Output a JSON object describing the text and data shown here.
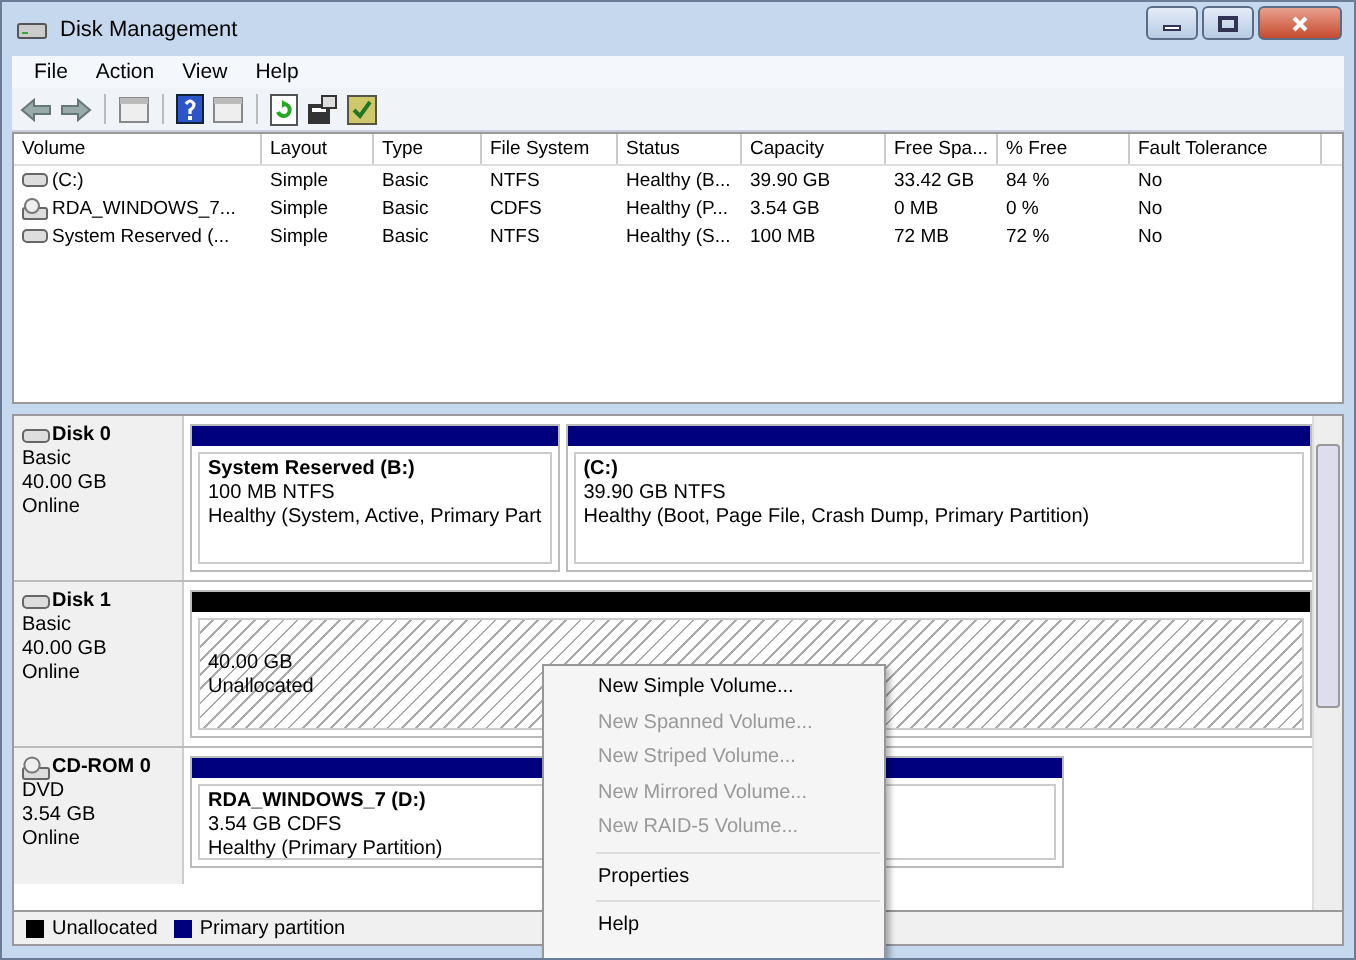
{
  "window": {
    "title": "Disk Management"
  },
  "menu": [
    "File",
    "Action",
    "View",
    "Help"
  ],
  "table": {
    "columns": [
      "Volume",
      "Layout",
      "Type",
      "File System",
      "Status",
      "Capacity",
      "Free Spa...",
      "% Free",
      "Fault Tolerance"
    ],
    "rows": [
      {
        "kind": "disk",
        "cells": [
          "(C:)",
          "Simple",
          "Basic",
          "NTFS",
          "Healthy (B...",
          "39.90 GB",
          "33.42 GB",
          "84 %",
          "No"
        ]
      },
      {
        "kind": "cd",
        "cells": [
          "RDA_WINDOWS_7...",
          "Simple",
          "Basic",
          "CDFS",
          "Healthy (P...",
          "3.54 GB",
          "0 MB",
          "0 %",
          "No"
        ]
      },
      {
        "kind": "disk",
        "cells": [
          "System Reserved (...",
          "Simple",
          "Basic",
          "NTFS",
          "Healthy (S...",
          "100 MB",
          "72 MB",
          "72 %",
          "No"
        ]
      }
    ]
  },
  "disks": [
    {
      "kind": "disk",
      "name": "Disk 0",
      "type": "Basic",
      "size": "40.00 GB",
      "state": "Online",
      "partitions": [
        {
          "kind": "primary",
          "name": "System Reserved  (B:)",
          "size": "100 MB NTFS",
          "status": "Healthy (System, Active, Primary Part"
        },
        {
          "kind": "primary",
          "name": "(C:)",
          "size": "39.90 GB NTFS",
          "status": "Healthy (Boot, Page File, Crash Dump, Primary Partition)"
        }
      ]
    },
    {
      "kind": "disk",
      "name": "Disk 1",
      "type": "Basic",
      "size": "40.00 GB",
      "state": "Online",
      "partitions": [
        {
          "kind": "unallocated",
          "size": "40.00 GB",
          "status": "Unallocated"
        }
      ]
    },
    {
      "kind": "cd",
      "name": "CD-ROM 0",
      "type": "DVD",
      "size": "3.54 GB",
      "state": "Online",
      "partitions": [
        {
          "kind": "primary",
          "name": "RDA_WINDOWS_7  (D:)",
          "size": "3.54 GB CDFS",
          "status": "Healthy (Primary Partition)"
        }
      ]
    }
  ],
  "legend": [
    {
      "kind": "unallocated",
      "label": "Unallocated"
    },
    {
      "kind": "primary",
      "label": "Primary partition"
    }
  ],
  "context_menu": [
    {
      "kind": "item",
      "label": "New Simple Volume...",
      "disabled": false
    },
    {
      "kind": "item",
      "label": "New Spanned Volume...",
      "disabled": true
    },
    {
      "kind": "item",
      "label": "New Striped Volume...",
      "disabled": true
    },
    {
      "kind": "item",
      "label": "New Mirrored Volume...",
      "disabled": true
    },
    {
      "kind": "item",
      "label": "New RAID-5 Volume...",
      "disabled": true
    },
    {
      "kind": "separator"
    },
    {
      "kind": "item",
      "label": "Properties",
      "disabled": false
    },
    {
      "kind": "separator"
    },
    {
      "kind": "item",
      "label": "Help",
      "disabled": false
    }
  ]
}
